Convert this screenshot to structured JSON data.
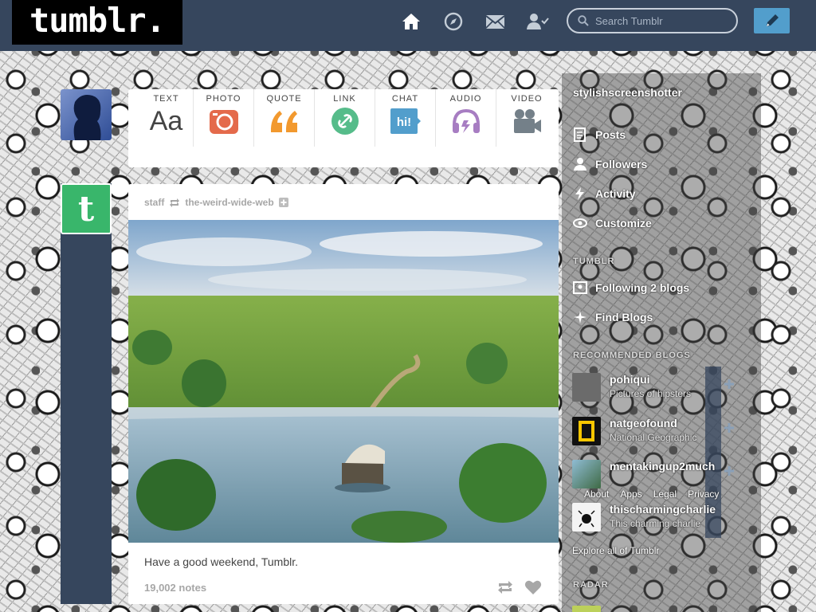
{
  "header": {
    "logo": "tumblr.",
    "search_placeholder": "Search Tumblr",
    "nav": [
      "home-icon",
      "explore-icon",
      "inbox-icon",
      "account-icon"
    ],
    "compose_icon": "pencil-icon"
  },
  "post_types": [
    {
      "label": "TEXT",
      "glyph": "Aa",
      "icon": "text-icon"
    },
    {
      "label": "PHOTO",
      "icon": "camera-icon",
      "color": "#e46a4b"
    },
    {
      "label": "QUOTE",
      "glyph": "“",
      "icon": "quote-icon",
      "color": "#f2992e"
    },
    {
      "label": "LINK",
      "icon": "link-icon",
      "color": "#56bc8a"
    },
    {
      "label": "CHAT",
      "glyph": "hi!",
      "icon": "chat-icon",
      "color": "#529ecc"
    },
    {
      "label": "AUDIO",
      "icon": "headphones-icon",
      "color": "#a77dc2"
    },
    {
      "label": "VIDEO",
      "icon": "video-camera-icon",
      "color": "#748089"
    }
  ],
  "post": {
    "author": "staff",
    "reblogged_from": "the-weird-wide-web",
    "caption": "Have a good weekend, Tumblr.",
    "notes": "19,002 notes"
  },
  "sidebar": {
    "blog_name": "stylishscreenshotter",
    "nav": [
      {
        "label": "Posts",
        "icon": "posts-icon"
      },
      {
        "label": "Followers",
        "icon": "followers-icon"
      },
      {
        "label": "Activity",
        "icon": "activity-icon"
      },
      {
        "label": "Customize",
        "icon": "customize-icon"
      }
    ],
    "following_section": "TUMBLR",
    "following": [
      {
        "label": "Following 2 blogs",
        "icon": "following-icon"
      },
      {
        "label": "Find Blogs",
        "icon": "find-blogs-icon"
      }
    ],
    "recommended_title": "RECOMMENDED BLOGS",
    "recommended": [
      {
        "name": "pohiqui",
        "desc": "Pictures of hipsters",
        "color": "#6b6b6b"
      },
      {
        "name": "natgeofound",
        "desc": "National Geographic",
        "color": "#111111"
      },
      {
        "name": "mentakingup2much",
        "desc": "",
        "color": "#4a7f9a"
      },
      {
        "name": "thischarmingcharlie",
        "desc": "This charming charlie",
        "color": "#f4f4f4"
      }
    ],
    "footer_links": [
      "About",
      "Apps",
      "Legal",
      "Privacy"
    ],
    "explore_link": "Explore all of Tumblr",
    "radar_title": "RADAR"
  }
}
